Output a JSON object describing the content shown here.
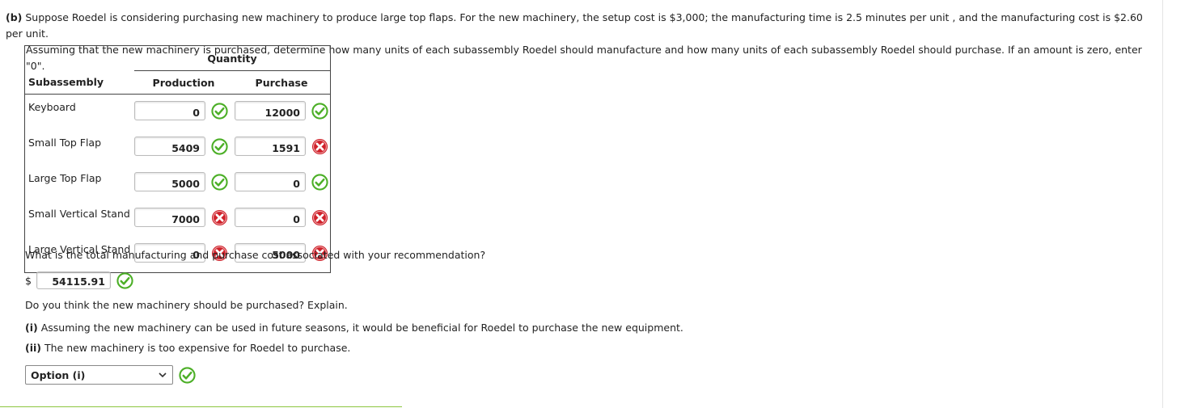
{
  "question": {
    "part_label": "(b)",
    "line1": "Suppose Roedel is considering purchasing new machinery to produce large top flaps. For the new machinery, the setup cost is $3,000; the manufacturing time is 2.5 minutes per unit , and the manufacturing cost is $2.60 per unit.",
    "line2": "Assuming that the new machinery is purchased, determine how many units of each subassembly Roedel should manufacture and how many units of each subassembly Roedel should purchase. If an amount is zero, enter \"0\"."
  },
  "table": {
    "group_header": "Quantity",
    "col_subassembly": "Subassembly",
    "col_production": "Production",
    "col_purchase": "Purchase",
    "rows": [
      {
        "label": "Keyboard",
        "production": "0",
        "production_status": "correct",
        "purchase": "12000",
        "purchase_status": "correct"
      },
      {
        "label": "Small Top Flap",
        "production": "5409",
        "production_status": "correct",
        "purchase": "1591",
        "purchase_status": "incorrect"
      },
      {
        "label": "Large Top Flap",
        "production": "5000",
        "production_status": "correct",
        "purchase": "0",
        "purchase_status": "correct"
      },
      {
        "label": "Small Vertical Stand",
        "production": "7000",
        "production_status": "incorrect",
        "purchase": "0",
        "purchase_status": "incorrect"
      },
      {
        "label": "Large Vertical Stand",
        "production": "0",
        "production_status": "incorrect",
        "purchase": "5000",
        "purchase_status": "incorrect"
      }
    ]
  },
  "total_cost": {
    "prompt": "What is the total manufacturing and purchase cost associated with your recommendation?",
    "currency": "$",
    "value": "54115.91",
    "status": "correct"
  },
  "explain": {
    "prompt": "Do you think the new machinery should be purchased? Explain.",
    "option1_label": "(i)",
    "option1_text": " Assuming the new machinery can be used in future seasons, it would be beneficial for Roedel to purchase the new equipment.",
    "option2_label": "(ii)",
    "option2_text": " The new machinery is too expensive for Roedel to purchase.",
    "selected": "Option (i)",
    "status": "correct"
  },
  "icons": {
    "correct": "green-check-circle-icon",
    "incorrect": "red-x-circle-icon",
    "dropdown": "chevron-down-icon"
  },
  "colors": {
    "correct": "#4caf27",
    "incorrect": "#d0212a",
    "accent_rule": "#8cc63f"
  }
}
